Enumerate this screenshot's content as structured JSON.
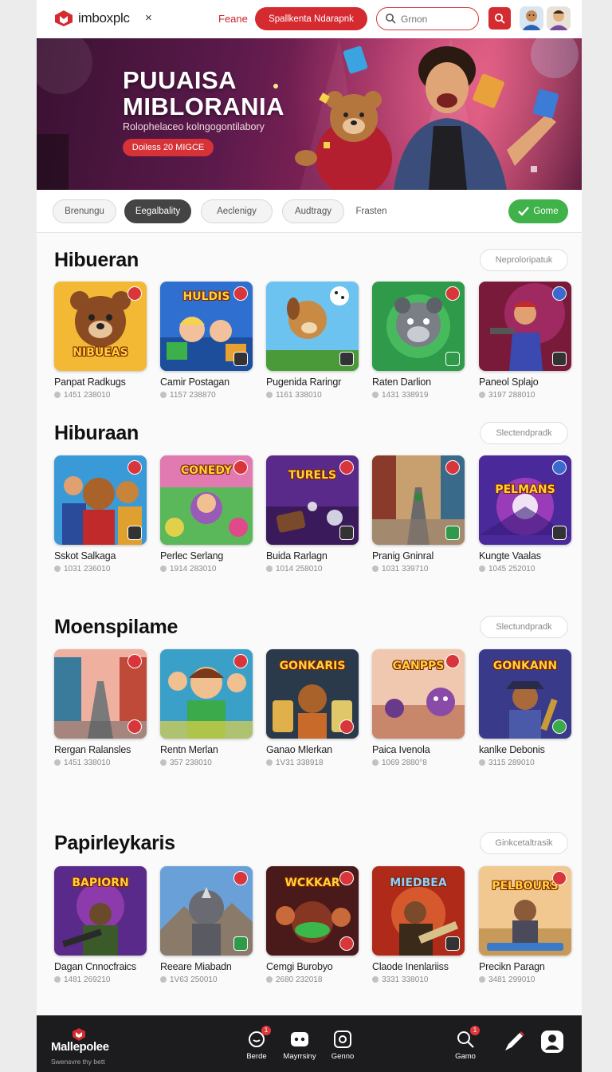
{
  "header": {
    "logo_text": "imboxplc",
    "logo_close": "×",
    "nav_link": "Feane",
    "cta_label": "Spallkenta Ndarapnk",
    "search_placeholder": "Grnon"
  },
  "hero": {
    "title": "PUUAISA MIBLORANIA",
    "subtitle": "Rolophelaceo kolngogontilabory",
    "button": "Doiless 20 MIGCE"
  },
  "filters": {
    "chips": [
      "Brenungu",
      "Eegalbality",
      "Aeclenigy",
      "Audtragy",
      "Frasten"
    ],
    "go_label": "Gome"
  },
  "sections": [
    {
      "title": "Hibueran",
      "more": "Neproloripatuk",
      "cards": [
        {
          "name": "Panpat Radkugs",
          "meta": "1451 238010",
          "art_word": "NIBUEAS"
        },
        {
          "name": "Camir Postagan",
          "meta": "1157 238870",
          "art_word": "HULDIS"
        },
        {
          "name": "Pugenida Raringr",
          "meta": "1161 338010",
          "art_word": ""
        },
        {
          "name": "Raten Darlion",
          "meta": "1431 338919",
          "art_word": ""
        },
        {
          "name": "Paneol Splajo",
          "meta": "3197 288010",
          "art_word": ""
        }
      ]
    },
    {
      "title": "Hiburaan",
      "more": "Slectendpradk",
      "cards": [
        {
          "name": "Sskot Salkaga",
          "meta": "1031 236010",
          "art_word": ""
        },
        {
          "name": "Perlec Serlang",
          "meta": "1914 283010",
          "art_word": "CONEDY"
        },
        {
          "name": "Buida Rarlagn",
          "meta": "1014 258010",
          "art_word": "TURELS"
        },
        {
          "name": "Pranig Gninral",
          "meta": "1031 339710",
          "art_word": ""
        },
        {
          "name": "Kungte Vaalas",
          "meta": "1045 252010",
          "art_word": "PELMANS"
        }
      ]
    },
    {
      "title": "Moenspilame",
      "more": "Slectundpradk",
      "cards": [
        {
          "name": "Rergan Ralansles",
          "meta": "1451 338010",
          "art_word": ""
        },
        {
          "name": "Rentn Merlan",
          "meta": "357 238010",
          "art_word": ""
        },
        {
          "name": "Ganao Mlerkan",
          "meta": "1V31 338918",
          "art_word": "GONKARIS"
        },
        {
          "name": "Paica Ivenola",
          "meta": "1069 2880°8",
          "art_word": "GANPPS"
        },
        {
          "name": "kanlke Debonis",
          "meta": "3115 289010",
          "art_word": "GONKANN"
        }
      ]
    },
    {
      "title": "Papirleykaris",
      "more": "Ginkcetaltrasik",
      "cards": [
        {
          "name": "Dagan Cnnocfraics",
          "meta": "1481 269210",
          "art_word": "BAPIORN"
        },
        {
          "name": "Reeare Miabadn",
          "meta": "1V63 250010",
          "art_word": ""
        },
        {
          "name": "Cemgi Burobyo",
          "meta": "2680 232018",
          "art_word": "WCKKAR"
        },
        {
          "name": "Claode Inenlariiss",
          "meta": "3331 338010",
          "art_word": "MIEDBEA"
        },
        {
          "name": "Precikn Paragn",
          "meta": "3481 299010",
          "art_word": "PELBOURS"
        }
      ]
    }
  ],
  "bottom_bar": {
    "brand_name": "Mallepolee",
    "brand_tagline": "Swensvre thy bett",
    "tabs": [
      {
        "label": "Berde",
        "badge": "1"
      },
      {
        "label": "Mayrrsiny",
        "badge": ""
      },
      {
        "label": "Genno",
        "badge": ""
      },
      {
        "label": "Gamo",
        "badge": "1"
      }
    ]
  },
  "colors": {
    "brand_red": "#d42a30",
    "success_green": "#3fb24a",
    "dark_bar": "#1c1c1e"
  }
}
